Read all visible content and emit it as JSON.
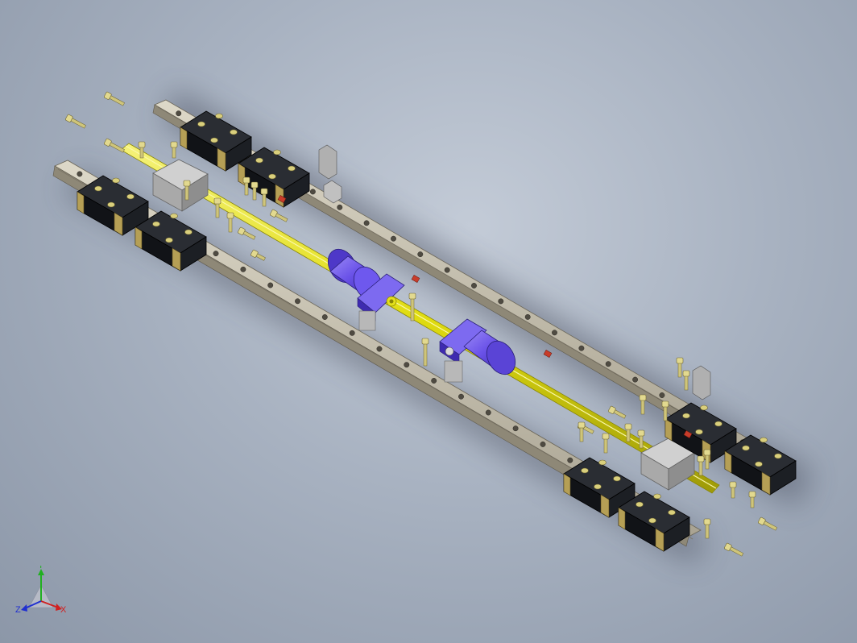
{
  "viewport": {
    "background": "#a8b2c1",
    "content": "cad-assembly-linear-rail-ballscrew"
  },
  "colors": {
    "rail": "#c8c2b2",
    "carriage": "#16181c",
    "carriage_band": "#b59f55",
    "screw": "#e4e01c",
    "nut": "#6b54e8",
    "support_block": "#b9b9b9",
    "bolt": "#d9cf7c",
    "fastener_red": "#c83c2a"
  },
  "triad": {
    "x_label": "X",
    "y_label": "Y",
    "z_label": "Z",
    "x_color": "#d02020",
    "y_color": "#20b020",
    "z_color": "#2030d0"
  }
}
